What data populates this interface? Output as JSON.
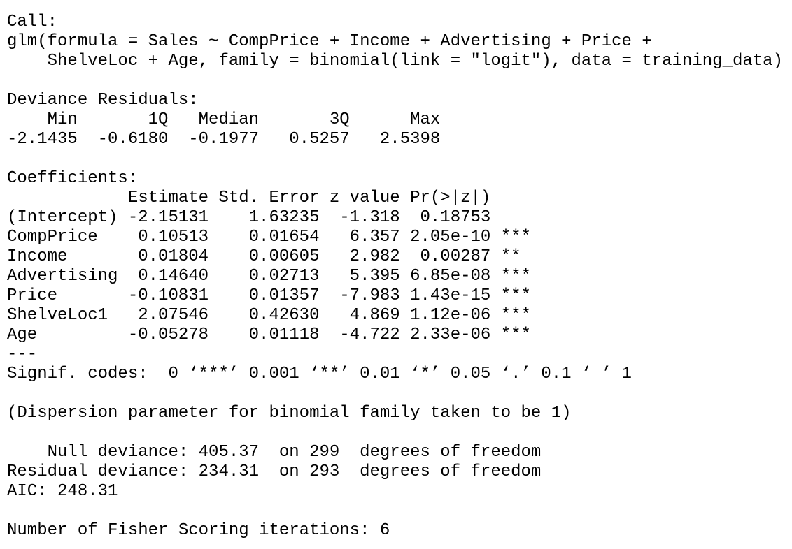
{
  "lines": [
    "Call:",
    "glm(formula = Sales ~ CompPrice + Income + Advertising + Price + ",
    "    ShelveLoc + Age, family = binomial(link = \"logit\"), data = training_data)",
    "",
    "Deviance Residuals: ",
    "    Min       1Q   Median       3Q      Max  ",
    "-2.1435  -0.6180  -0.1977   0.5257   2.5398  ",
    "",
    "Coefficients:",
    "            Estimate Std. Error z value Pr(>|z|)    ",
    "(Intercept) -2.15131    1.63235  -1.318  0.18753    ",
    "CompPrice    0.10513    0.01654   6.357 2.05e-10 ***",
    "Income       0.01804    0.00605   2.982  0.00287 ** ",
    "Advertising  0.14640    0.02713   5.395 6.85e-08 ***",
    "Price       -0.10831    0.01357  -7.983 1.43e-15 ***",
    "ShelveLoc1   2.07546    0.42630   4.869 1.12e-06 ***",
    "Age         -0.05278    0.01118  -4.722 2.33e-06 ***",
    "---",
    "Signif. codes:  0 ‘***’ 0.001 ‘**’ 0.01 ‘*’ 0.05 ‘.’ 0.1 ‘ ’ 1",
    "",
    "(Dispersion parameter for binomial family taken to be 1)",
    "",
    "    Null deviance: 405.37  on 299  degrees of freedom",
    "Residual deviance: 234.31  on 293  degrees of freedom",
    "AIC: 248.31",
    "",
    "Number of Fisher Scoring iterations: 6"
  ]
}
